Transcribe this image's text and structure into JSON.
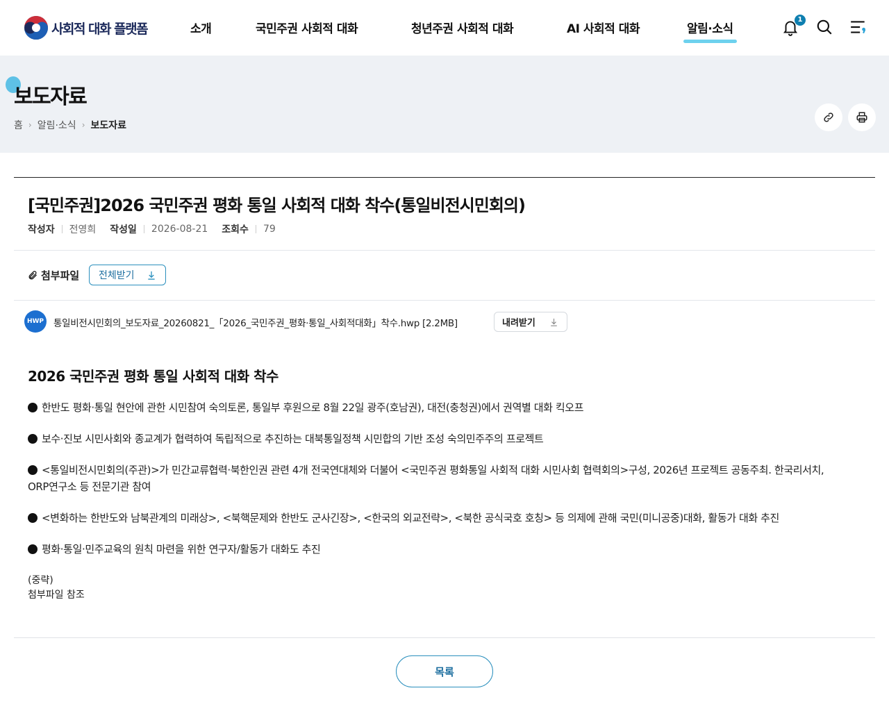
{
  "header": {
    "logo_text": "사회적 대화 플랫폼",
    "nav": [
      {
        "label": "소개"
      },
      {
        "label": "국민주권 사회적 대화"
      },
      {
        "label": "청년주권 사회적 대화"
      },
      {
        "label": "AI 사회적 대화"
      },
      {
        "label": "알림·소식"
      }
    ],
    "active_nav": "알림·소식",
    "notification_count": "1",
    "icons": [
      "bell-icon",
      "search-icon",
      "menu-icon"
    ]
  },
  "banner": {
    "title": "보도자료",
    "breadcrumb": [
      "홈",
      "알림·소식",
      "보도자료"
    ],
    "actions": [
      "link-icon",
      "print-icon"
    ]
  },
  "article": {
    "title": "[국민주권]2026 국민주권 평화 통일 사회적 대화 착수(통일비전시민회의)",
    "meta": {
      "author_label": "작성자",
      "author": "전영희",
      "date_label": "작성일",
      "date": "2026-08-21",
      "views_label": "조회수",
      "views": "79"
    },
    "attachment": {
      "label": "첨부파일",
      "download_all": "전체받기",
      "file_type": "HWP",
      "file_name": "통일비전시민회의_보도자료_20260821_「2026_국민주권_평화·통일_사회적대화」착수.hwp [2.2MB]",
      "download": "내려받기"
    },
    "body_heading": "2026 국민주권 평화 통일 사회적 대화 착수",
    "bullets": [
      "한반도 평화·통일 현안에 관한 시민참여 숙의토론, 통일부 후원으로 8월 22일 광주(호남권), 대전(충청권)에서 권역별 대화 킥오프",
      "보수·진보 시민사회와 종교계가 협력하여 독립적으로 추진하는 대북통일정책 시민합의 기반 조성 숙의민주주의 프로젝트",
      "<통일비전시민회의(주관)>가 민간교류협력·북한인권 관련 4개 전국연대체와 더불어 <국민주권 평화통일 사회적 대화 시민사회 협력회의>구성, 2026년 프로젝트 공동주최. 한국리서치,        ORP연구소 등 전문기관 참여",
      "<변화하는 한반도와 남북관계의 미래상>, <북핵문제와 한반도 군사긴장>, <한국의 외교전략>, <북한 공식국호 호칭> 등 의제에 관해 국민(미니공중)대화, 활동가 대화 추진",
      "평화·통일·민주교육의 원칙 마련을 위한 연구자/활동가 대화도 추진"
    ],
    "omitted": "(중략)",
    "see_attachment": "첨부파일 참조"
  },
  "footer": {
    "list_button": "목록"
  },
  "colors": {
    "accent": "#1e6fa0",
    "nav_underline": "#6dd1ee",
    "banner_bg": "#eef1f5"
  }
}
